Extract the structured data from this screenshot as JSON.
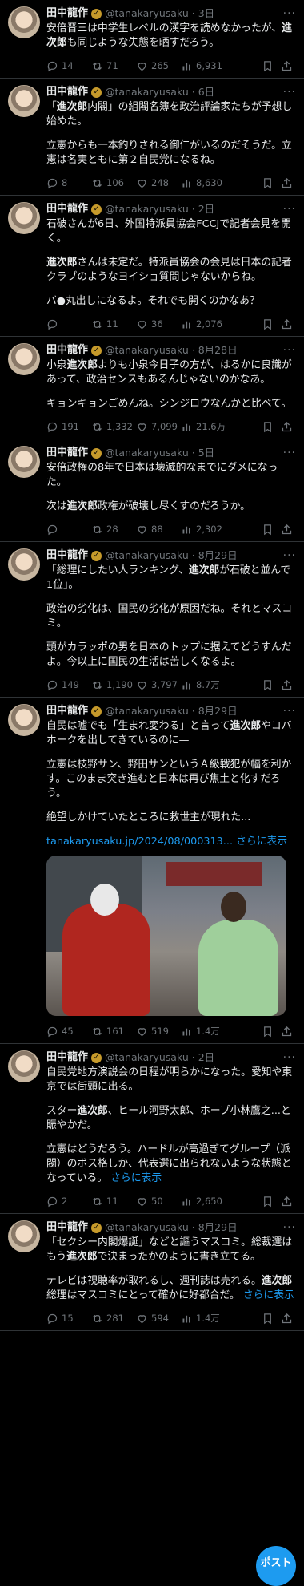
{
  "author": {
    "name": "田中龍作",
    "handle": "@tanakaryusaku",
    "verified_icon": "verified-badge-gold"
  },
  "colors": {
    "accent": "#1d9bf0",
    "muted": "#71767b",
    "background": "#000000"
  },
  "tweets": [
    {
      "date": "3日",
      "paras": [
        [
          {
            "t": "安倍晋三は中学生レベルの漢字を読めなかったが、"
          },
          {
            "t": "進次郎",
            "b": true
          },
          {
            "t": "も同じような失態を晒すだろう。"
          }
        ]
      ],
      "replies": "14",
      "retweets": "71",
      "likes": "265",
      "views": "6,931"
    },
    {
      "date": "6日",
      "paras": [
        [
          {
            "t": "「"
          },
          {
            "t": "進次郎",
            "b": true
          },
          {
            "t": "内閣」の組閣名簿を政治評論家たちが予想し始めた。"
          }
        ],
        [
          {
            "t": "立憲からも一本釣りされる御仁がいるのだそうだ。立憲は名実ともに第２自民党になるね。"
          }
        ]
      ],
      "replies": "8",
      "retweets": "106",
      "likes": "248",
      "views": "8,630"
    },
    {
      "date": "2日",
      "paras": [
        [
          {
            "t": "石破さんが6日、外国特派員協会FCCJで記者会見を開く。"
          }
        ],
        [
          {
            "t": "進次郎",
            "b": true
          },
          {
            "t": "さんは未定だ。特派員協会の会見は日本の記者クラブのようなヨイショ質問じゃないからね。"
          }
        ],
        [
          {
            "t": "バ●丸出しになるよ。それでも開くのかなあ？"
          }
        ]
      ],
      "replies": "",
      "retweets": "11",
      "likes": "36",
      "views": "2,076"
    },
    {
      "date": "8月28日",
      "paras": [
        [
          {
            "t": "小泉"
          },
          {
            "t": "進次郎",
            "b": true
          },
          {
            "t": "よりも小泉今日子の方が、はるかに良識があって、政治センスもあるんじゃないのかなあ。"
          }
        ],
        [
          {
            "t": "キョンキョンごめんね。シンジロウなんかと比べて。"
          }
        ]
      ],
      "replies": "191",
      "retweets": "1,332",
      "likes": "7,099",
      "views": "21.6万"
    },
    {
      "date": "5日",
      "paras": [
        [
          {
            "t": "安倍政権の8年で日本は壊滅的なまでにダメになった。"
          }
        ],
        [
          {
            "t": "次は"
          },
          {
            "t": "進次郎",
            "b": true
          },
          {
            "t": "政権が破壊し尽くすのだろうか。"
          }
        ]
      ],
      "replies": "",
      "retweets": "28",
      "likes": "88",
      "views": "2,302"
    },
    {
      "date": "8月29日",
      "paras": [
        [
          {
            "t": "「総理にしたい人ランキング、"
          },
          {
            "t": "進次郎",
            "b": true
          },
          {
            "t": "が石破と並んで1位」。"
          }
        ],
        [
          {
            "t": "政治の劣化は、国民の劣化が原因だね。それとマスコミ。"
          }
        ],
        [
          {
            "t": "頭がカラッポの男を日本のトップに据えてどうすんだよ。今以上に国民の生活は苦しくなるよ。"
          }
        ]
      ],
      "replies": "149",
      "retweets": "1,190",
      "likes": "3,797",
      "views": "8.7万"
    },
    {
      "date": "8月29日",
      "paras": [
        [
          {
            "t": "自民は嘘でも「生まれ変わる」と言って"
          },
          {
            "t": "進次郎",
            "b": true
          },
          {
            "t": "やコバホークを出してきているのに—"
          }
        ],
        [
          {
            "t": "立憲は枝野サン、野田サンというＡ級戦犯が幅を利かす。このまま突き進むと日本は再び焦土と化すだろう。"
          }
        ],
        [
          {
            "t": "絶望しかけていたところに救世主が現れた..."
          }
        ],
        [
          {
            "t": "tanakaryusaku.jp/2024/08/000313...",
            "link": true
          },
          {
            "t": " "
          },
          {
            "t": "さらに表示",
            "more": true
          }
        ]
      ],
      "media": true,
      "replies": "45",
      "retweets": "161",
      "likes": "519",
      "views": "1.4万"
    },
    {
      "date": "2日",
      "paras": [
        [
          {
            "t": "自民党地方演説会の日程が明らかになった。愛知や東京では街頭に出る。"
          }
        ],
        [
          {
            "t": "スター"
          },
          {
            "t": "進次郎",
            "b": true
          },
          {
            "t": "、ヒール河野太郎、ホープ小林鷹之...と賑やかだ。"
          }
        ],
        [
          {
            "t": "立憲はどうだろう。ハードルが高過ぎてグループ（派閥）のボス格しか、代表選に出られないような状態となっている。 "
          },
          {
            "t": "さらに表示",
            "more": true
          }
        ]
      ],
      "replies": "2",
      "retweets": "11",
      "likes": "50",
      "views": "2,650"
    },
    {
      "date": "8月29日",
      "paras": [
        [
          {
            "t": "「セクシー内閣爆誕」などと謳うマスコミ。総裁選はもう"
          },
          {
            "t": "進次郎",
            "b": true
          },
          {
            "t": "で決まったかのように書き立てる。"
          }
        ],
        [
          {
            "t": "テレビは視聴率が取れるし、週刊誌は売れる。"
          },
          {
            "t": "進次郎",
            "b": true
          },
          {
            "t": "総理はマスコミにとって確かに好都合だ。 "
          },
          {
            "t": "さらに表示",
            "more": true
          }
        ]
      ],
      "replies": "15",
      "retweets": "281",
      "likes": "594",
      "views": "1.4万"
    }
  ],
  "compose": {
    "label": "ポスト"
  }
}
